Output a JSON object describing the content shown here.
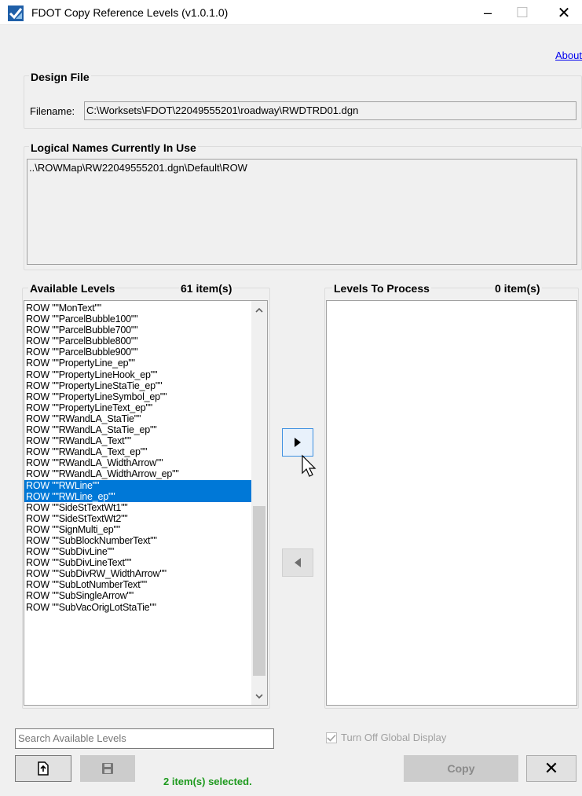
{
  "window": {
    "title": "FDOT Copy Reference Levels (v1.0.1.0)",
    "minimize": "–",
    "maximize": "☐",
    "close": "✕"
  },
  "about_link": "About",
  "design_file": {
    "legend": "Design File",
    "filename_label": "Filename:",
    "filename_value": "C:\\Worksets\\FDOT\\22049555201\\roadway\\RWDTRD01.dgn"
  },
  "logical_names": {
    "legend": "Logical Names Currently In Use",
    "value": "..\\ROWMap\\RW22049555201.dgn\\Default\\ROW"
  },
  "available_levels": {
    "header": "Available Levels",
    "count": "61 item(s)",
    "items": [
      {
        "label": "ROW \"\"MonText\"\"",
        "selected": false
      },
      {
        "label": "ROW \"\"ParcelBubble100\"\"",
        "selected": false
      },
      {
        "label": "ROW \"\"ParcelBubble700\"\"",
        "selected": false
      },
      {
        "label": "ROW \"\"ParcelBubble800\"\"",
        "selected": false
      },
      {
        "label": "ROW \"\"ParcelBubble900\"\"",
        "selected": false
      },
      {
        "label": "ROW \"\"PropertyLine_ep\"\"",
        "selected": false
      },
      {
        "label": "ROW \"\"PropertyLineHook_ep\"\"",
        "selected": false
      },
      {
        "label": "ROW \"\"PropertyLineStaTie_ep\"\"",
        "selected": false
      },
      {
        "label": "ROW \"\"PropertyLineSymbol_ep\"\"",
        "selected": false
      },
      {
        "label": "ROW \"\"PropertyLineText_ep\"\"",
        "selected": false
      },
      {
        "label": "ROW \"\"RWandLA_StaTie\"\"",
        "selected": false
      },
      {
        "label": "ROW \"\"RWandLA_StaTie_ep\"\"",
        "selected": false
      },
      {
        "label": "ROW \"\"RWandLA_Text\"\"",
        "selected": false
      },
      {
        "label": "ROW \"\"RWandLA_Text_ep\"\"",
        "selected": false
      },
      {
        "label": "ROW \"\"RWandLA_WidthArrow\"\"",
        "selected": false
      },
      {
        "label": "ROW \"\"RWandLA_WidthArrow_ep\"\"",
        "selected": false
      },
      {
        "label": "ROW \"\"RWLine\"\"",
        "selected": true
      },
      {
        "label": "ROW \"\"RWLine_ep\"\"",
        "selected": true
      },
      {
        "label": "ROW \"\"SideStTextWt1\"\"",
        "selected": false
      },
      {
        "label": "ROW \"\"SideStTextWt2\"\"",
        "selected": false
      },
      {
        "label": "ROW \"\"SignMulti_ep\"\"",
        "selected": false
      },
      {
        "label": "ROW \"\"SubBlockNumberText\"\"",
        "selected": false
      },
      {
        "label": "ROW \"\"SubDivLine\"\"",
        "selected": false
      },
      {
        "label": "ROW \"\"SubDivLineText\"\"",
        "selected": false
      },
      {
        "label": "ROW \"\"SubDivRW_WidthArrow\"\"",
        "selected": false
      },
      {
        "label": "ROW \"\"SubLotNumberText\"\"",
        "selected": false
      },
      {
        "label": "ROW \"\"SubSingleArrow\"\"",
        "selected": false
      },
      {
        "label": "ROW \"\"SubVacOrigLotStaTie\"\"",
        "selected": false
      }
    ]
  },
  "levels_to_process": {
    "header": "Levels To Process",
    "count": "0 item(s)"
  },
  "search": {
    "placeholder": "Search Available Levels"
  },
  "turn_off_global_display": {
    "label": "Turn Off Global Display",
    "checked": true,
    "enabled": false
  },
  "buttons": {
    "copy": "Copy",
    "close": "✕"
  },
  "status": "2 item(s) selected.",
  "colors": {
    "selection": "#0078d7",
    "status_green": "#1e9a1e",
    "link": "#0000ee"
  }
}
